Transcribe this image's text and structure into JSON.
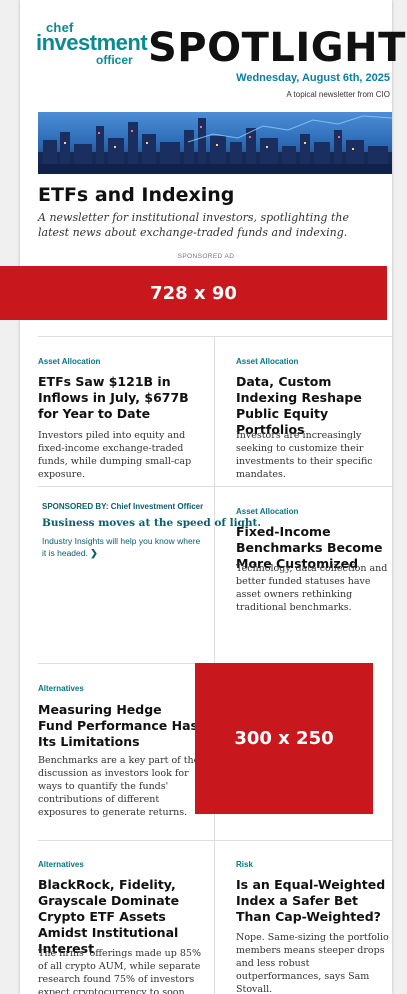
{
  "header": {
    "logo_line1": "chef",
    "logo_line2": "investment",
    "logo_line3": "officer",
    "title": "SPOTLIGHT",
    "date": "Wednesday, August 6th, 2025",
    "tagline": "A topical newsletter from CIO"
  },
  "section": {
    "title": "ETFs and Indexing",
    "description": "A newsletter for institutional investors, spotlighting the latest news about exchange-traded funds and indexing."
  },
  "sponsored_ad_label": "SPONSORED AD",
  "ads": {
    "top": "728 x 90",
    "side": "300 x 250"
  },
  "articles": [
    {
      "category": "Asset Allocation",
      "headline": "ETFs Saw $121B in Inflows in July, $677B for Year to Date",
      "summary": "Investors piled into equity and fixed-income exchange-traded funds, while dumping small-cap exposure."
    },
    {
      "category": "Asset Allocation",
      "headline": "Data, Custom Indexing Reshape Public Equity Portfolios",
      "summary": "Investors are increasingly seeking to customize their investments to their specific mandates."
    },
    {
      "category": "Asset Allocation",
      "headline": "Fixed-Income Benchmarks Become More Customized",
      "summary": "Technology, data collection and better funded statuses have asset owners rethinking traditional benchmarks."
    },
    {
      "category": "Alternatives",
      "headline": "Measuring Hedge Fund Performance Has Its Limitations",
      "summary": "Benchmarks are a key part of the discussion as investors look for ways to quantify the funds' contributions of different exposures to generate returns."
    },
    {
      "category": "Alternatives",
      "headline": "BlackRock, Fidelity, Grayscale Dominate Crypto ETF Assets Amidst Institutional Interest",
      "summary": "The firms' offerings made up 85% of all crypto AUM, while separate research found 75% of investors expect cryptocurrency to soon"
    },
    {
      "category": "Risk",
      "headline": "Is an Equal-Weighted Index a Safer Bet Than Cap-Weighted?",
      "summary": "Nope. Same-sizing the portfolio members means steeper drops and less robust outperformances, says Sam Stovall."
    }
  ],
  "sponsor": {
    "label": "SPONSORED BY: Chief Investment Officer",
    "headline": "Business moves at the speed of light.",
    "body": "Industry Insights will help you know where it is headed.",
    "chevron": "❯"
  }
}
